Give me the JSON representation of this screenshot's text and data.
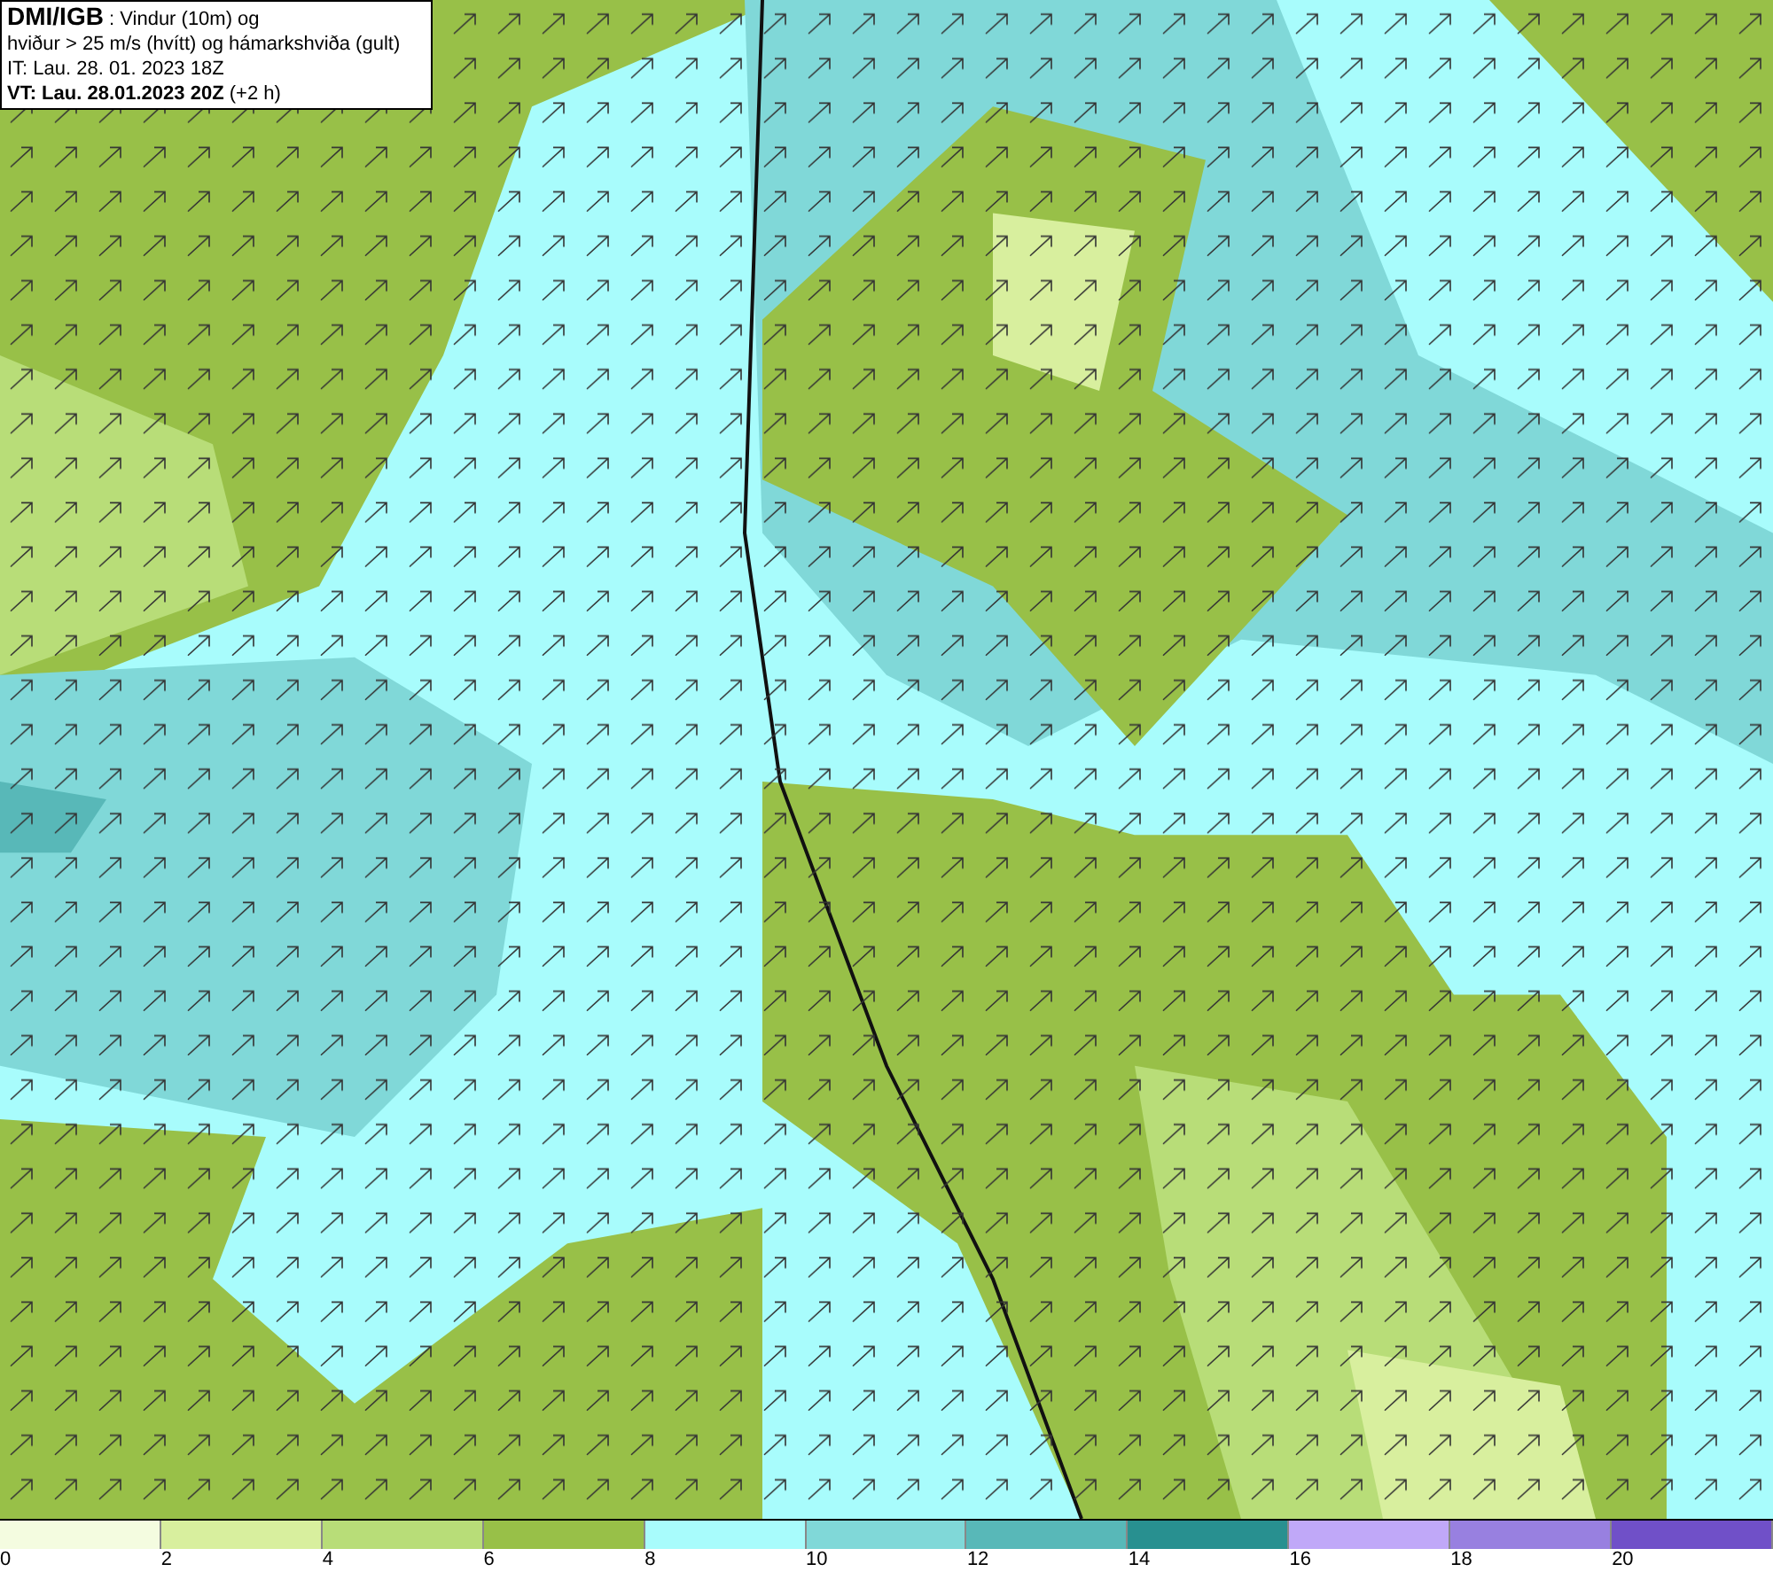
{
  "header": {
    "lines": [
      "**DMI/IGB** : Vindur (10m) og",
      "hviður > 25 m/s (hvítt) og hámarkshviða (gult)",
      "IT: Lau. 28. 01. 2023 18Z",
      "**VT: Lau. 28.01.2023 20Z** (+2 h)"
    ]
  },
  "legend": [
    {
      "label": "0",
      "color": "#f4fce0"
    },
    {
      "label": "2",
      "color": "#d8ef9e"
    },
    {
      "label": "4",
      "color": "#b8dd78"
    },
    {
      "label": "6",
      "color": "#98c048"
    },
    {
      "label": "8",
      "color": "#a8fcfc"
    },
    {
      "label": "10",
      "color": "#80d8d8"
    },
    {
      "label": "12",
      "color": "#58b8b8"
    },
    {
      "label": "14",
      "color": "#289090"
    },
    {
      "label": "16",
      "color": "#c0a8f8"
    },
    {
      "label": "18",
      "color": "#9880e0"
    },
    {
      "label": "20",
      "color": "#7050c8"
    }
  ]
}
